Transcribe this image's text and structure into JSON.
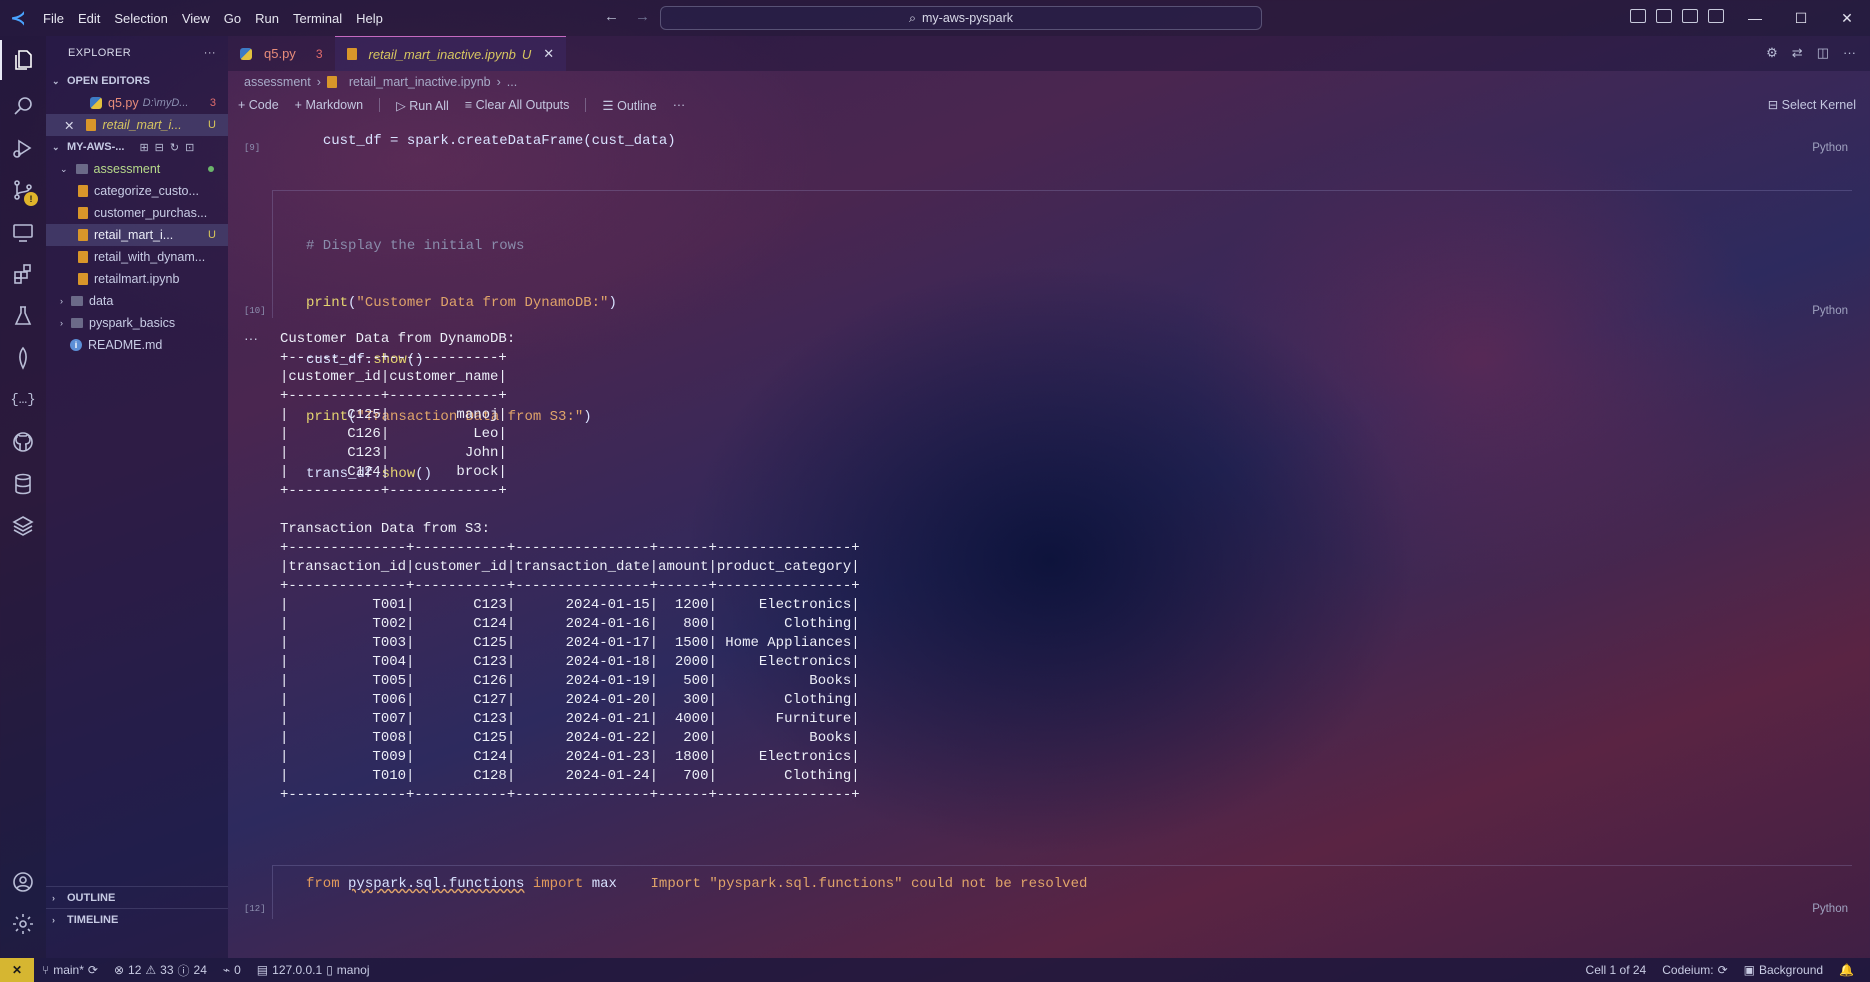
{
  "window": {
    "menu": [
      "File",
      "Edit",
      "Selection",
      "View",
      "Go",
      "Run",
      "Terminal",
      "Help"
    ],
    "search_text": "my-aws-pyspark"
  },
  "sidebar": {
    "title": "EXPLORER",
    "open_editors_label": "OPEN EDITORS",
    "open_editors": [
      {
        "name": "q5.py",
        "detail": "D:\\myD...",
        "count": "3"
      },
      {
        "name": "retail_mart_i...",
        "status": "U"
      }
    ],
    "workspace_label": "MY-AWS-...",
    "folder": "assessment",
    "files": [
      {
        "name": "categorize_custo..."
      },
      {
        "name": "customer_purchas..."
      },
      {
        "name": "retail_mart_i...",
        "status": "U"
      },
      {
        "name": "retail_with_dynam..."
      },
      {
        "name": "retailmart.ipynb"
      }
    ],
    "other": [
      "data",
      "pyspark_basics"
    ],
    "readme": "README.md",
    "outline_label": "OUTLINE",
    "timeline_label": "TIMELINE"
  },
  "tabs": [
    {
      "name": "q5.py",
      "count": "3"
    },
    {
      "name": "retail_mart_inactive.ipynb",
      "status": "U"
    }
  ],
  "breadcrumb": [
    "assessment",
    "retail_mart_inactive.ipynb",
    "..."
  ],
  "toolbar": {
    "code": "Code",
    "markdown": "Markdown",
    "run_all": "Run All",
    "clear": "Clear All Outputs",
    "outline": "Outline",
    "more": "···",
    "select_kernel": "Select Kernel"
  },
  "cells": {
    "cell9": {
      "count": "[9]",
      "code": "cust_df = spark.createDataFrame(cust_data)",
      "lang": "Python"
    },
    "cell10": {
      "count": "[10]",
      "comment": "# Display the initial rows",
      "line2_fn": "print",
      "line2_str": "\"Customer Data from DynamoDB:\"",
      "line3": "cust_df",
      "line3_fn": "show",
      "line4_fn": "print",
      "line4_str": "\"Transaction Data from S3:\"",
      "line5": "trans_df",
      "line5_fn": "show",
      "lang": "Python"
    },
    "cell12": {
      "count": "[12]",
      "kw_from": "from",
      "module": "pyspark.sql.functions",
      "kw_import": "import",
      "name": "max",
      "warning": "Import \"pyspark.sql.functions\" could not be resolved",
      "lang": "Python"
    }
  },
  "output": {
    "customer_title": "Customer Data from DynamoDB:",
    "customer_headers": [
      "customer_id",
      "customer_name"
    ],
    "customers": [
      [
        "C125",
        "manoj"
      ],
      [
        "C126",
        "Leo"
      ],
      [
        "C123",
        "John"
      ],
      [
        "C124",
        "brock"
      ]
    ],
    "transaction_title": "Transaction Data from S3:",
    "transaction_headers": [
      "transaction_id",
      "customer_id",
      "transaction_date",
      "amount",
      "product_category"
    ],
    "transactions": [
      [
        "T001",
        "C123",
        "2024-01-15",
        "1200",
        "Electronics"
      ],
      [
        "T002",
        "C124",
        "2024-01-16",
        "800",
        "Clothing"
      ],
      [
        "T003",
        "C125",
        "2024-01-17",
        "1500",
        "Home Appliances"
      ],
      [
        "T004",
        "C123",
        "2024-01-18",
        "2000",
        "Electronics"
      ],
      [
        "T005",
        "C126",
        "2024-01-19",
        "500",
        "Books"
      ],
      [
        "T006",
        "C127",
        "2024-01-20",
        "300",
        "Clothing"
      ],
      [
        "T007",
        "C123",
        "2024-01-21",
        "4000",
        "Furniture"
      ],
      [
        "T008",
        "C125",
        "2024-01-22",
        "200",
        "Books"
      ],
      [
        "T009",
        "C124",
        "2024-01-23",
        "1800",
        "Electronics"
      ],
      [
        "T010",
        "C128",
        "2024-01-24",
        "700",
        "Clothing"
      ]
    ]
  },
  "status": {
    "branch": "main*",
    "errors": "12",
    "warnings": "33",
    "info": "24",
    "ports": "0",
    "host": "127.0.0.1",
    "user": "manoj",
    "cell": "Cell 1 of 24",
    "codeium": "Codeium:",
    "background": "Background"
  }
}
